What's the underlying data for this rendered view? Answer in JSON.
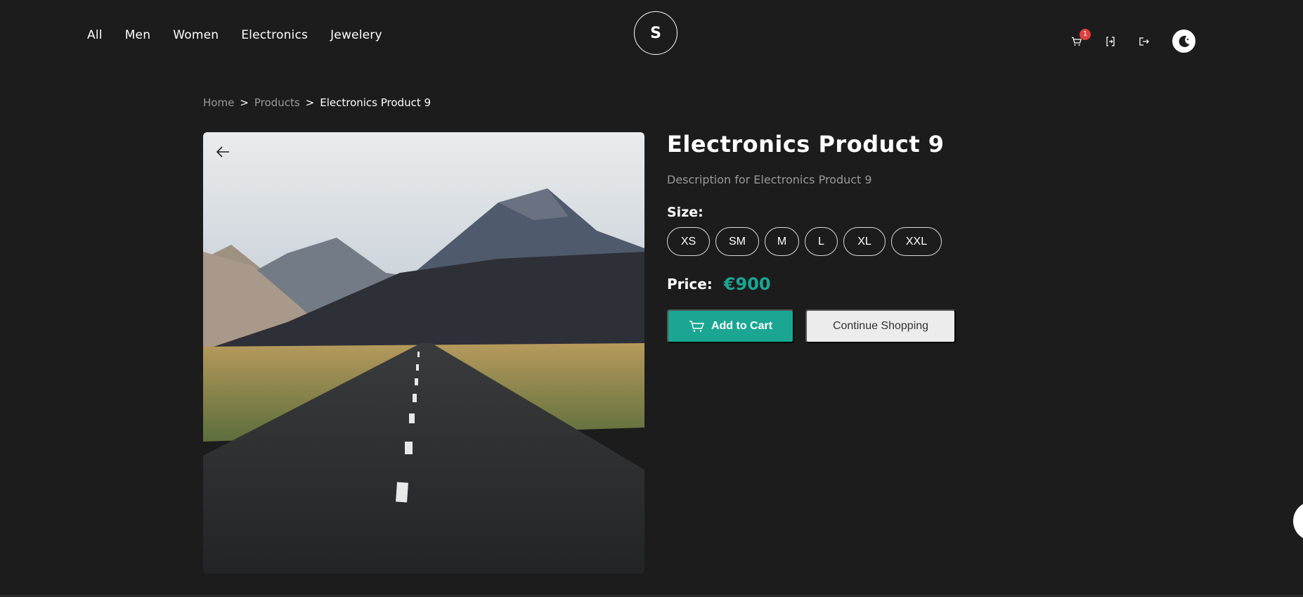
{
  "header": {
    "nav": [
      "All",
      "Men",
      "Women",
      "Electronics",
      "Jewelery"
    ],
    "logo_letter": "S",
    "cart_count": "1",
    "icons": [
      "cart-icon",
      "login-icon",
      "logout-icon",
      "moon-icon"
    ]
  },
  "breadcrumb": {
    "home": "Home",
    "sep": ">",
    "products": "Products",
    "current": "Electronics Product 9"
  },
  "product": {
    "title": "Electronics Product 9",
    "description": "Description for Electronics Product 9",
    "size_label": "Size:",
    "sizes": [
      "XS",
      "SM",
      "M",
      "L",
      "XL",
      "XXL"
    ],
    "price_label": "Price:",
    "price": "€900",
    "add_to_cart": "Add to Cart",
    "continue_shopping": "Continue Shopping"
  },
  "colors": {
    "background": "#1c1c1d",
    "accent": "#1aa693",
    "badge": "#e0403b",
    "muted_text": "#9a9a9a"
  }
}
